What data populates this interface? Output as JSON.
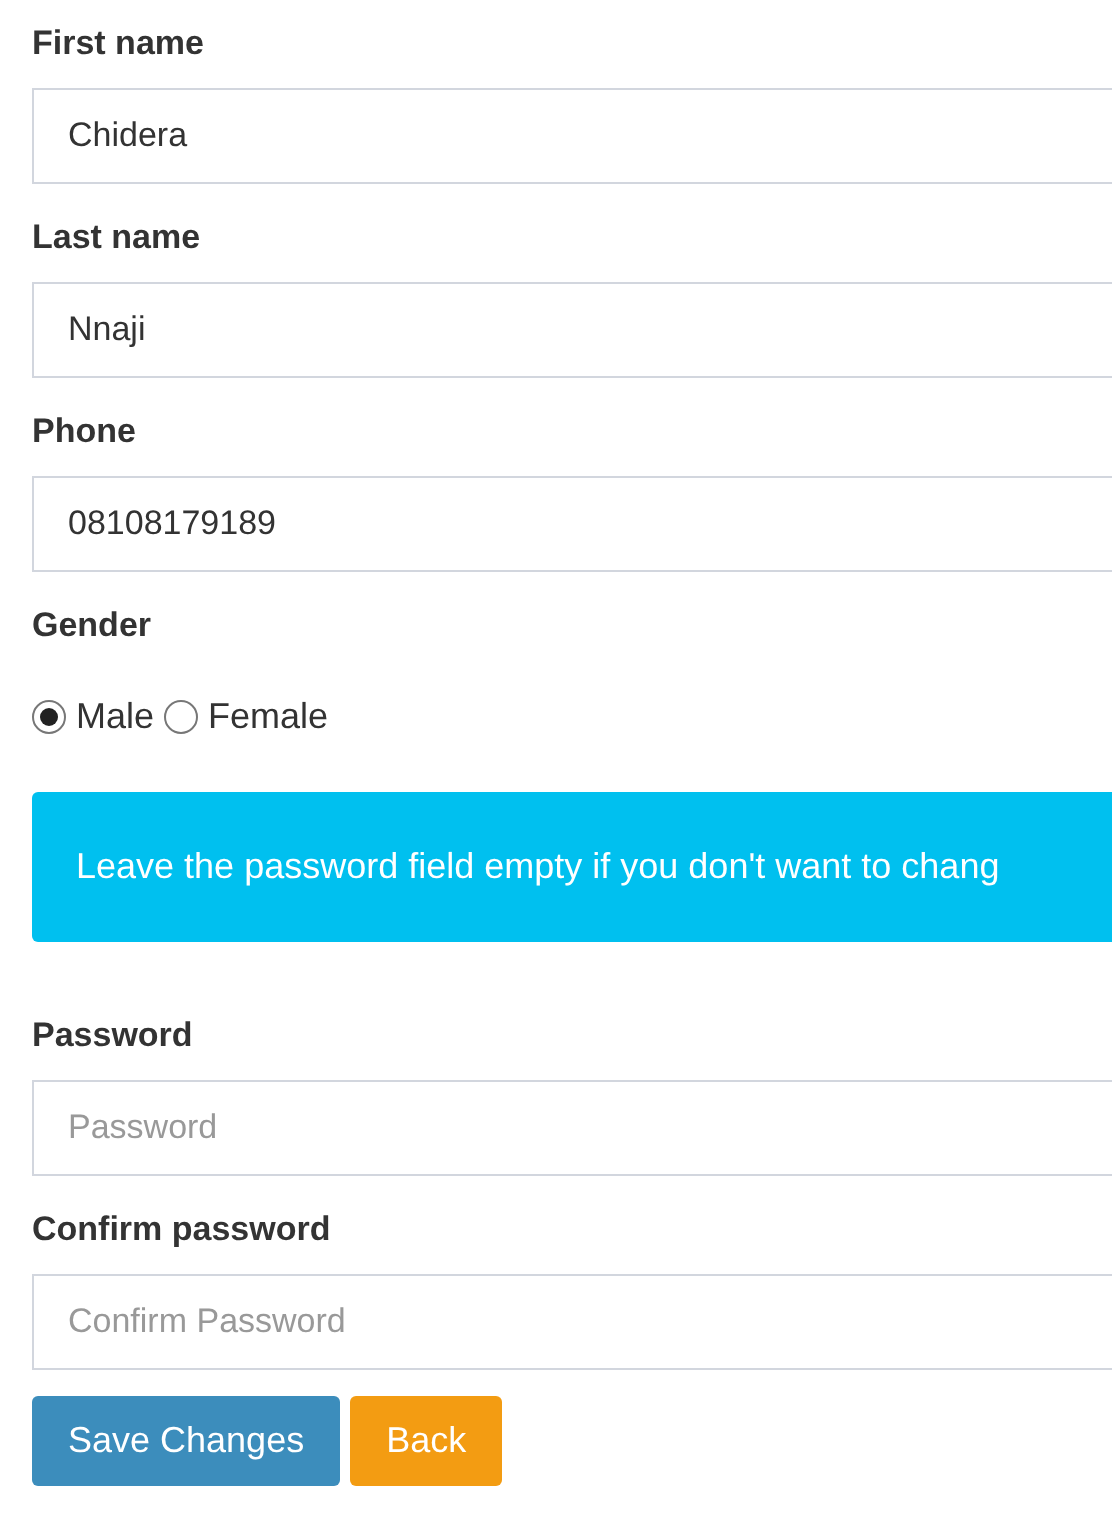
{
  "fields": [
    {
      "kind": "text",
      "label": "First name",
      "value": "Chidera"
    },
    {
      "kind": "text",
      "label": "Last name",
      "value": "Nnaji"
    },
    {
      "kind": "text",
      "label": "Phone",
      "value": "08108179189"
    },
    {
      "kind": "radio",
      "label": "Gender",
      "options": [
        {
          "label": "Male",
          "selected": true
        },
        {
          "label": "Female",
          "selected": false
        }
      ]
    },
    {
      "kind": "alert",
      "text": "Leave the password field empty if you don't want to chang"
    },
    {
      "kind": "password",
      "label": "Password",
      "placeholder": "Password"
    },
    {
      "kind": "password",
      "label": "Confirm password",
      "placeholder": "Confirm Password"
    }
  ],
  "buttons": [
    {
      "kind": "primary",
      "label": "Save Changes"
    },
    {
      "kind": "warning",
      "label": "Back"
    }
  ]
}
